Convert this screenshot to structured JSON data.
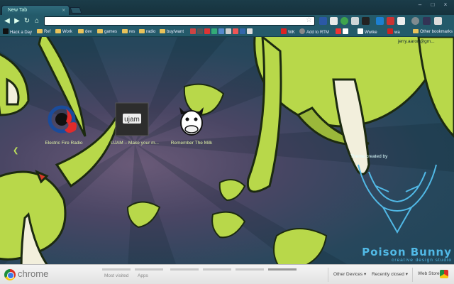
{
  "tabs": [
    {
      "label": "New Tab"
    }
  ],
  "omnibox": {
    "value": "",
    "placeholder": ""
  },
  "bookmarks": [
    {
      "label": "Hack a Day",
      "type": "site"
    },
    {
      "label": "Ref",
      "type": "folder"
    },
    {
      "label": "Work",
      "type": "folder"
    },
    {
      "label": "dev",
      "type": "folder"
    },
    {
      "label": "games",
      "type": "folder"
    },
    {
      "label": "res",
      "type": "folder"
    },
    {
      "label": "radio",
      "type": "folder"
    },
    {
      "label": "buy/want",
      "type": "folder"
    },
    {
      "label": "WK",
      "type": "site"
    },
    {
      "label": "Add to RTM",
      "type": "site"
    },
    {
      "label": "Wwike",
      "type": "site"
    },
    {
      "label": "wa",
      "type": "site"
    }
  ],
  "other_bookmarks": "Other bookmarks",
  "signed_in_user": "jerry.aaron@gm...",
  "most_visited": [
    {
      "title": "Electric Fire Radio"
    },
    {
      "title": "UJAM – Make your m..."
    },
    {
      "title": "Remember The Milk"
    }
  ],
  "theme": {
    "credit_label": "Theme created by",
    "logo_text": "Poison Bunny",
    "logo_subtext": "creative design studio"
  },
  "footer": {
    "brand": "chrome",
    "tabs": [
      "Most visited",
      "Apps"
    ],
    "links": [
      "Other Devices ▾",
      "Recently closed ▾",
      "Web Store"
    ]
  },
  "colors": {
    "accent": "#bfe35a",
    "frame": "#245a6a",
    "logo_blue": "#51b9e6"
  }
}
